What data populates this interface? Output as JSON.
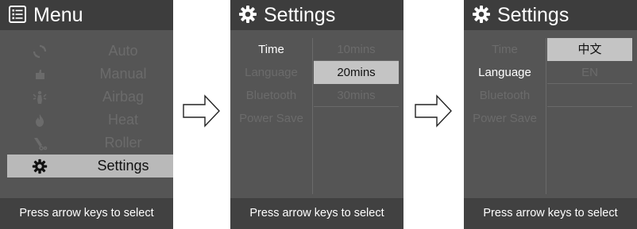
{
  "screens": [
    {
      "title": "Menu",
      "title_icon": "list-icon",
      "items": [
        {
          "label": "Auto",
          "icon": "cycle-icon"
        },
        {
          "label": "Manual",
          "icon": "hand-icon"
        },
        {
          "label": "Airbag",
          "icon": "airbag-icon"
        },
        {
          "label": "Heat",
          "icon": "flame-icon"
        },
        {
          "label": "Roller",
          "icon": "roller-icon"
        },
        {
          "label": "Settings",
          "icon": "gear-icon",
          "selected": true
        }
      ],
      "footer": "Press arrow keys to select"
    },
    {
      "title": "Settings",
      "title_icon": "gear-icon",
      "categories": [
        "Time",
        "Language",
        "Bluetooth",
        "Power Save"
      ],
      "active_category": "Time",
      "options": [
        "10mins",
        "20mins",
        "30mins"
      ],
      "selected_option": "20mins",
      "footer": "Press arrow keys to select"
    },
    {
      "title": "Settings",
      "title_icon": "gear-icon",
      "categories": [
        "Time",
        "Language",
        "Bluetooth",
        "Power Save"
      ],
      "active_category": "Language",
      "options": [
        "中文",
        "EN"
      ],
      "selected_option": "中文",
      "footer": "Press arrow keys to select"
    }
  ],
  "colors": {
    "header_bg": "#3d3d3d",
    "body_bg": "#555555",
    "footer_bg": "#414141",
    "selection_bg": "#b9b9b9",
    "dim_text": "#6b6b6b",
    "active_text": "#ffffff"
  }
}
